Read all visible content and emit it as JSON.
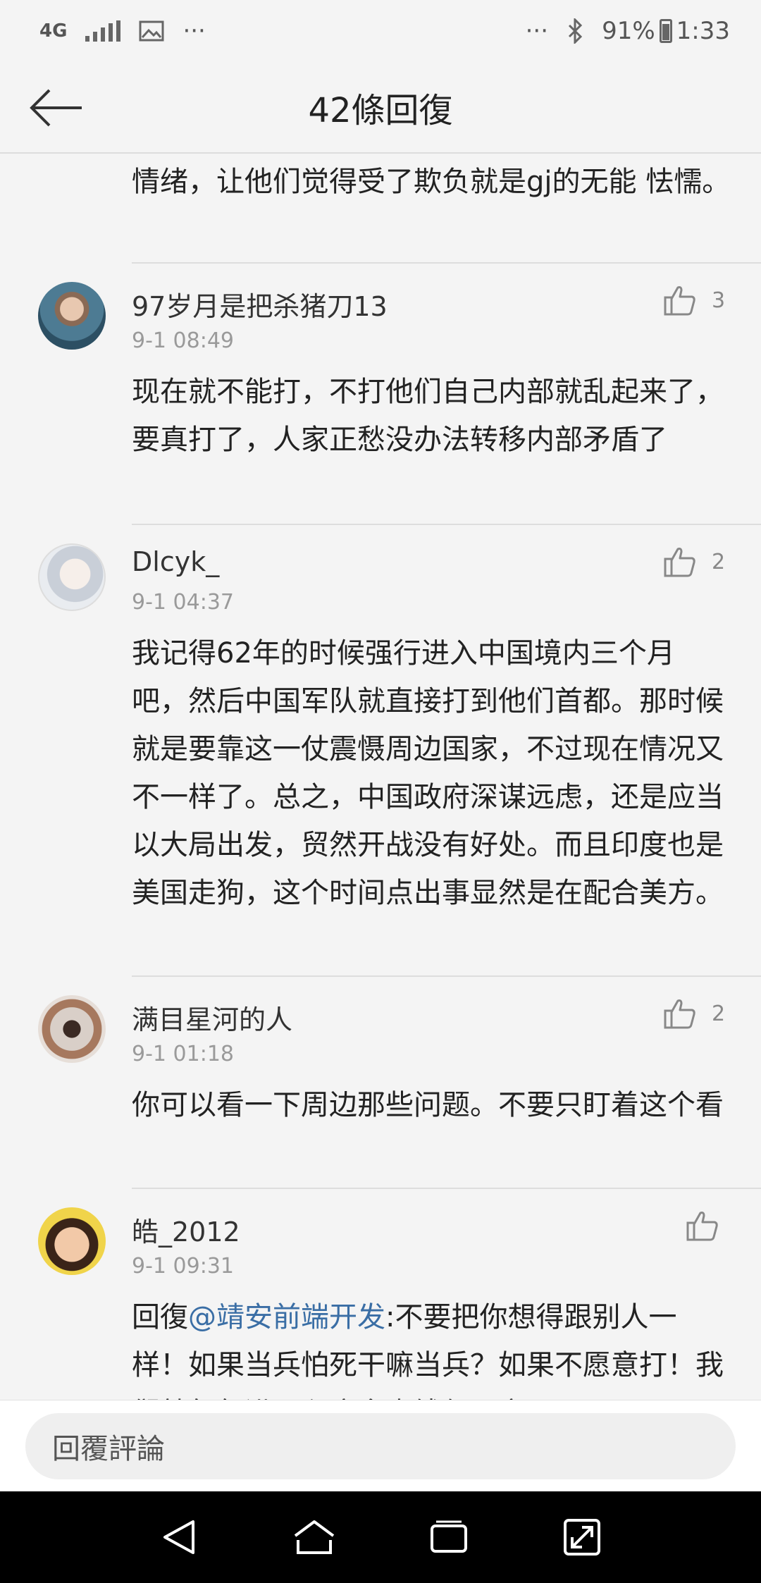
{
  "status_bar": {
    "network": "4G",
    "more": "···",
    "more_right": "···",
    "battery": "91%",
    "time": "1:33"
  },
  "header": {
    "title": "42條回復"
  },
  "partial_comment": {
    "text": "情绪，让他们觉得受了欺负就是gj的无能 怯懦。"
  },
  "comments": [
    {
      "name": "97岁月是把杀猪刀13",
      "time": "9-1 08:49",
      "likes": "3",
      "text": "现在就不能打，不打他们自己内部就乱起来了，要真打了，人家正愁没办法转移内部矛盾了"
    },
    {
      "name": "Dlcyk_",
      "time": "9-1 04:37",
      "likes": "2",
      "text": "我记得62年的时候强行进入中国境内三个月吧，然后中国军队就直接打到他们首都。那时候就是要靠这一仗震慑周边国家，不过现在情况又不一样了。总之，中国政府深谋远虑，还是应当以大局出发，贸然开战没有好处。而且印度也是美国走狗，这个时间点出事显然是在配合美方。"
    },
    {
      "name": "满目星河的人",
      "time": "9-1 01:18",
      "likes": "2",
      "text": "你可以看一下周边那些问题。不要只盯着这个看"
    },
    {
      "name": "皓_2012",
      "time": "9-1 09:31",
      "likes": "",
      "reply_prefix": "回復",
      "mention": "@靖安前端开发",
      "text": ":不要把你想得跟别人一样！如果当兵怕死干嘛当兵？如果不愿意打！我们就每年进贡印度多少钱保平安！"
    }
  ],
  "reply_bar": {
    "placeholder": "回覆評論"
  },
  "colors": {
    "background": "#f4f4f4",
    "mention": "#3a6ea5",
    "nav_bar": "#000000"
  }
}
